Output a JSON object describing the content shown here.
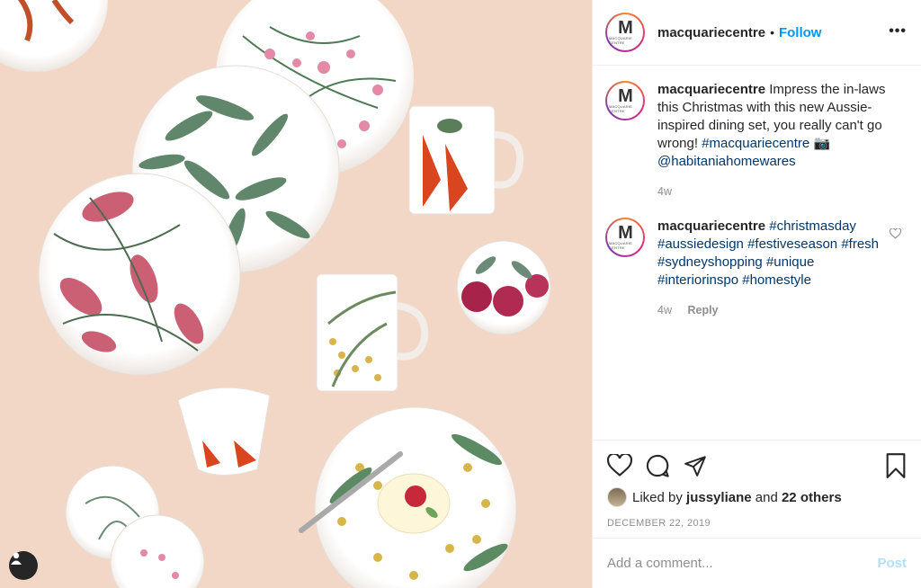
{
  "post": {
    "username": "macquariecentre",
    "follow_label": "Follow",
    "more_label": "•••",
    "avatar_letter": "M",
    "avatar_subtext": "MACQUARIE CENTRE"
  },
  "comments": [
    {
      "username": "macquariecentre",
      "text": "Impress the in-laws this Christmas with this new Aussie-inspired dining set, you really can't go wrong!",
      "hashtag": "#macquariecentre",
      "emoji": "📷",
      "mention": "@habitaniahomewares",
      "age": "4w"
    },
    {
      "username": "macquariecentre",
      "tags": [
        "#christmasday",
        "#aussiedesign",
        "#festiveseason",
        "#fresh",
        "#sydneyshopping",
        "#unique",
        "#interiorinspo",
        "#homestyle"
      ],
      "age": "4w",
      "reply_label": "Reply"
    }
  ],
  "likes": {
    "prefix": "Liked by",
    "user": "jussyliane",
    "mid": "and",
    "others": "22 others"
  },
  "date": "DECEMBER 22, 2019",
  "add_comment": {
    "placeholder": "Add a comment...",
    "post_label": "Post"
  },
  "icons": {
    "like": "heart-icon",
    "comment": "comment-icon",
    "share": "share-icon",
    "save": "bookmark-icon",
    "user_tag": "user-tag-icon"
  },
  "colors": {
    "link": "#00376b",
    "follow": "#0095f6",
    "post_disabled": "#b2dffc",
    "photo_background": "#f3d7c6"
  }
}
